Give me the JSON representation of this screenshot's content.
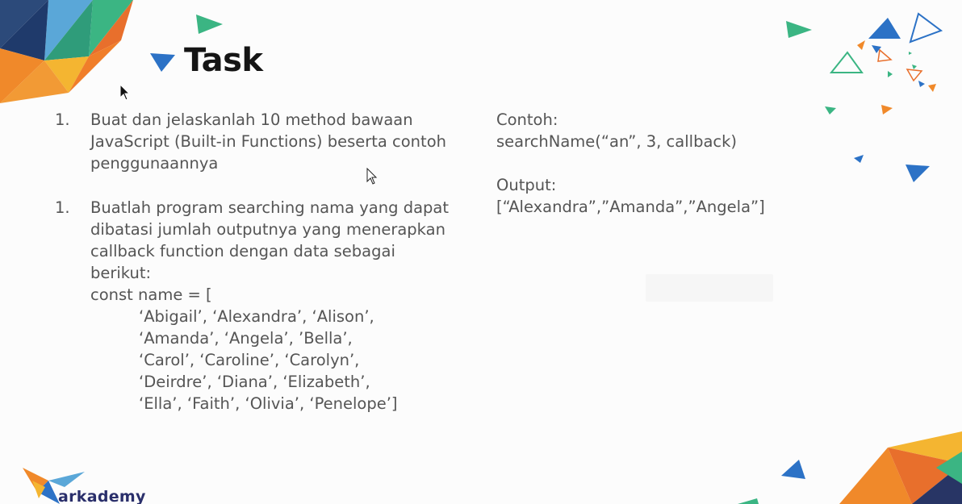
{
  "slide": {
    "title": "Task",
    "task1": {
      "number": "1.",
      "lines": [
        "Buat dan jelaskanlah 10 method bawaan",
        "JavaScript (Built-in Functions) beserta contoh",
        "penggunaannya"
      ]
    },
    "task2": {
      "number": "1.",
      "lines": [
        "Buatlah program searching nama yang dapat",
        "dibatasi jumlah outputnya yang menerapkan",
        "callback function dengan data sebagai",
        "berikut:",
        "const name = ["
      ],
      "code_lines": [
        "‘Abigail’, ‘Alexandra’, ‘Alison’,",
        "‘Amanda’, ‘Angela’, ’Bella’,",
        "‘Carol’, ‘Caroline’, ‘Carolyn’,",
        "‘Deirdre’, ‘Diana’, ‘Elizabeth’,",
        "‘Ella’, ‘Faith’, ‘Olivia’, ‘Penelope’]"
      ]
    },
    "example": {
      "label": "Contoh:",
      "call": "searchName(“an”, 3, callback)",
      "output_label": "Output:",
      "output": "[“Alexandra”,”Amanda”,”Angela”]"
    },
    "brand": "arkademy"
  },
  "colors": {
    "green": "#3bb583",
    "blue": "#2c72c6",
    "orange": "#f0892a",
    "yellow": "#f4b531",
    "navy": "#283565",
    "text": "#555555",
    "title": "#151515"
  },
  "icons": [
    "pointer-cursor-icon",
    "pointer-cursor-icon",
    "arkademy-bird-logo-icon"
  ]
}
